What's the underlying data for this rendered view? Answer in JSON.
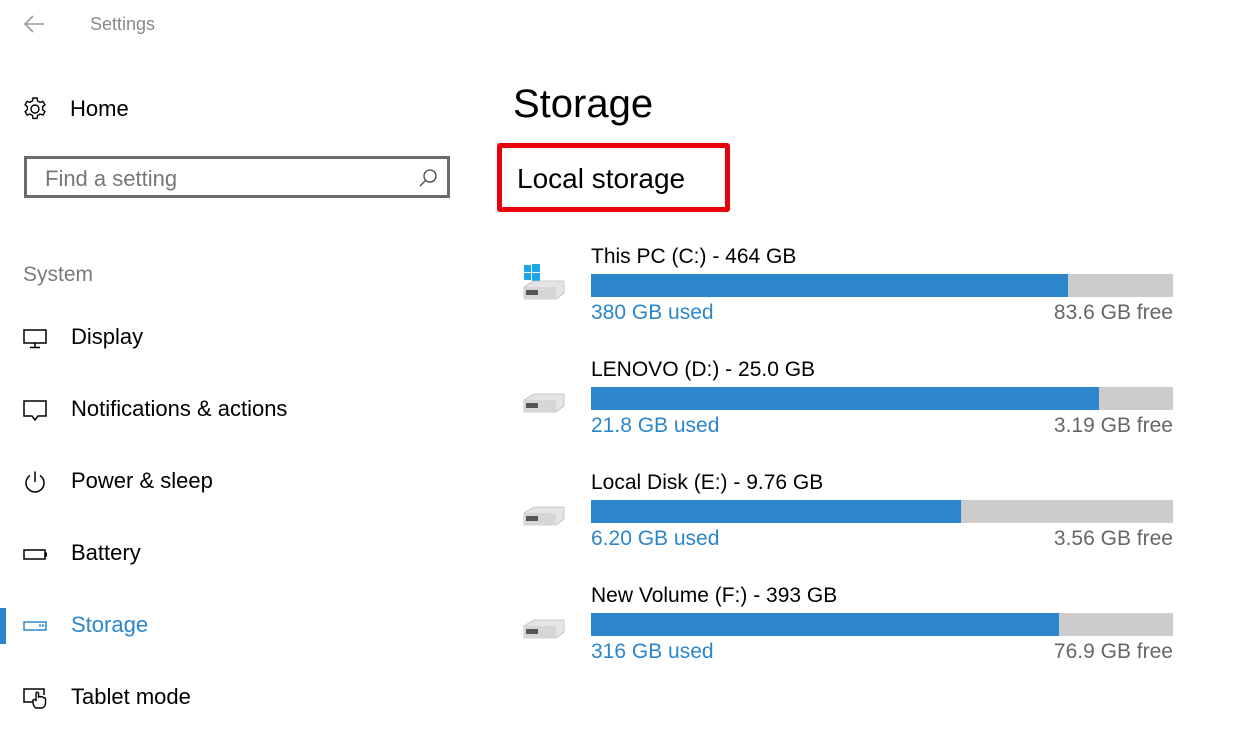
{
  "window": {
    "title": "Settings"
  },
  "sidebar": {
    "home_label": "Home",
    "search": {
      "placeholder": "Find a setting",
      "value": ""
    },
    "section_label": "System",
    "items": [
      {
        "label": "Display",
        "icon": "display-icon",
        "active": false
      },
      {
        "label": "Notifications & actions",
        "icon": "notifications-icon",
        "active": false
      },
      {
        "label": "Power & sleep",
        "icon": "power-icon",
        "active": false
      },
      {
        "label": "Battery",
        "icon": "battery-icon",
        "active": false
      },
      {
        "label": "Storage",
        "icon": "storage-icon",
        "active": true
      },
      {
        "label": "Tablet mode",
        "icon": "tablet-mode-icon",
        "active": false
      }
    ]
  },
  "main": {
    "title": "Storage",
    "section_title": "Local storage",
    "drives": [
      {
        "name": "This PC (C:) - 464 GB",
        "used": "380 GB used",
        "free": "83.6 GB free",
        "used_fraction": 0.819,
        "icon": "system-drive-icon"
      },
      {
        "name": "LENOVO (D:) - 25.0 GB",
        "used": "21.8 GB used",
        "free": "3.19 GB free",
        "used_fraction": 0.872,
        "icon": "drive-icon"
      },
      {
        "name": "Local Disk (E:) - 9.76 GB",
        "used": "6.20 GB used",
        "free": "3.56 GB free",
        "used_fraction": 0.635,
        "icon": "drive-icon"
      },
      {
        "name": "New Volume (F:) - 393 GB",
        "used": "316 GB used",
        "free": "76.9 GB free",
        "used_fraction": 0.804,
        "icon": "drive-icon"
      }
    ]
  },
  "colors": {
    "accent": "#2b86cb",
    "bar_track": "#cccccc",
    "highlight_box": "#e8000b"
  }
}
